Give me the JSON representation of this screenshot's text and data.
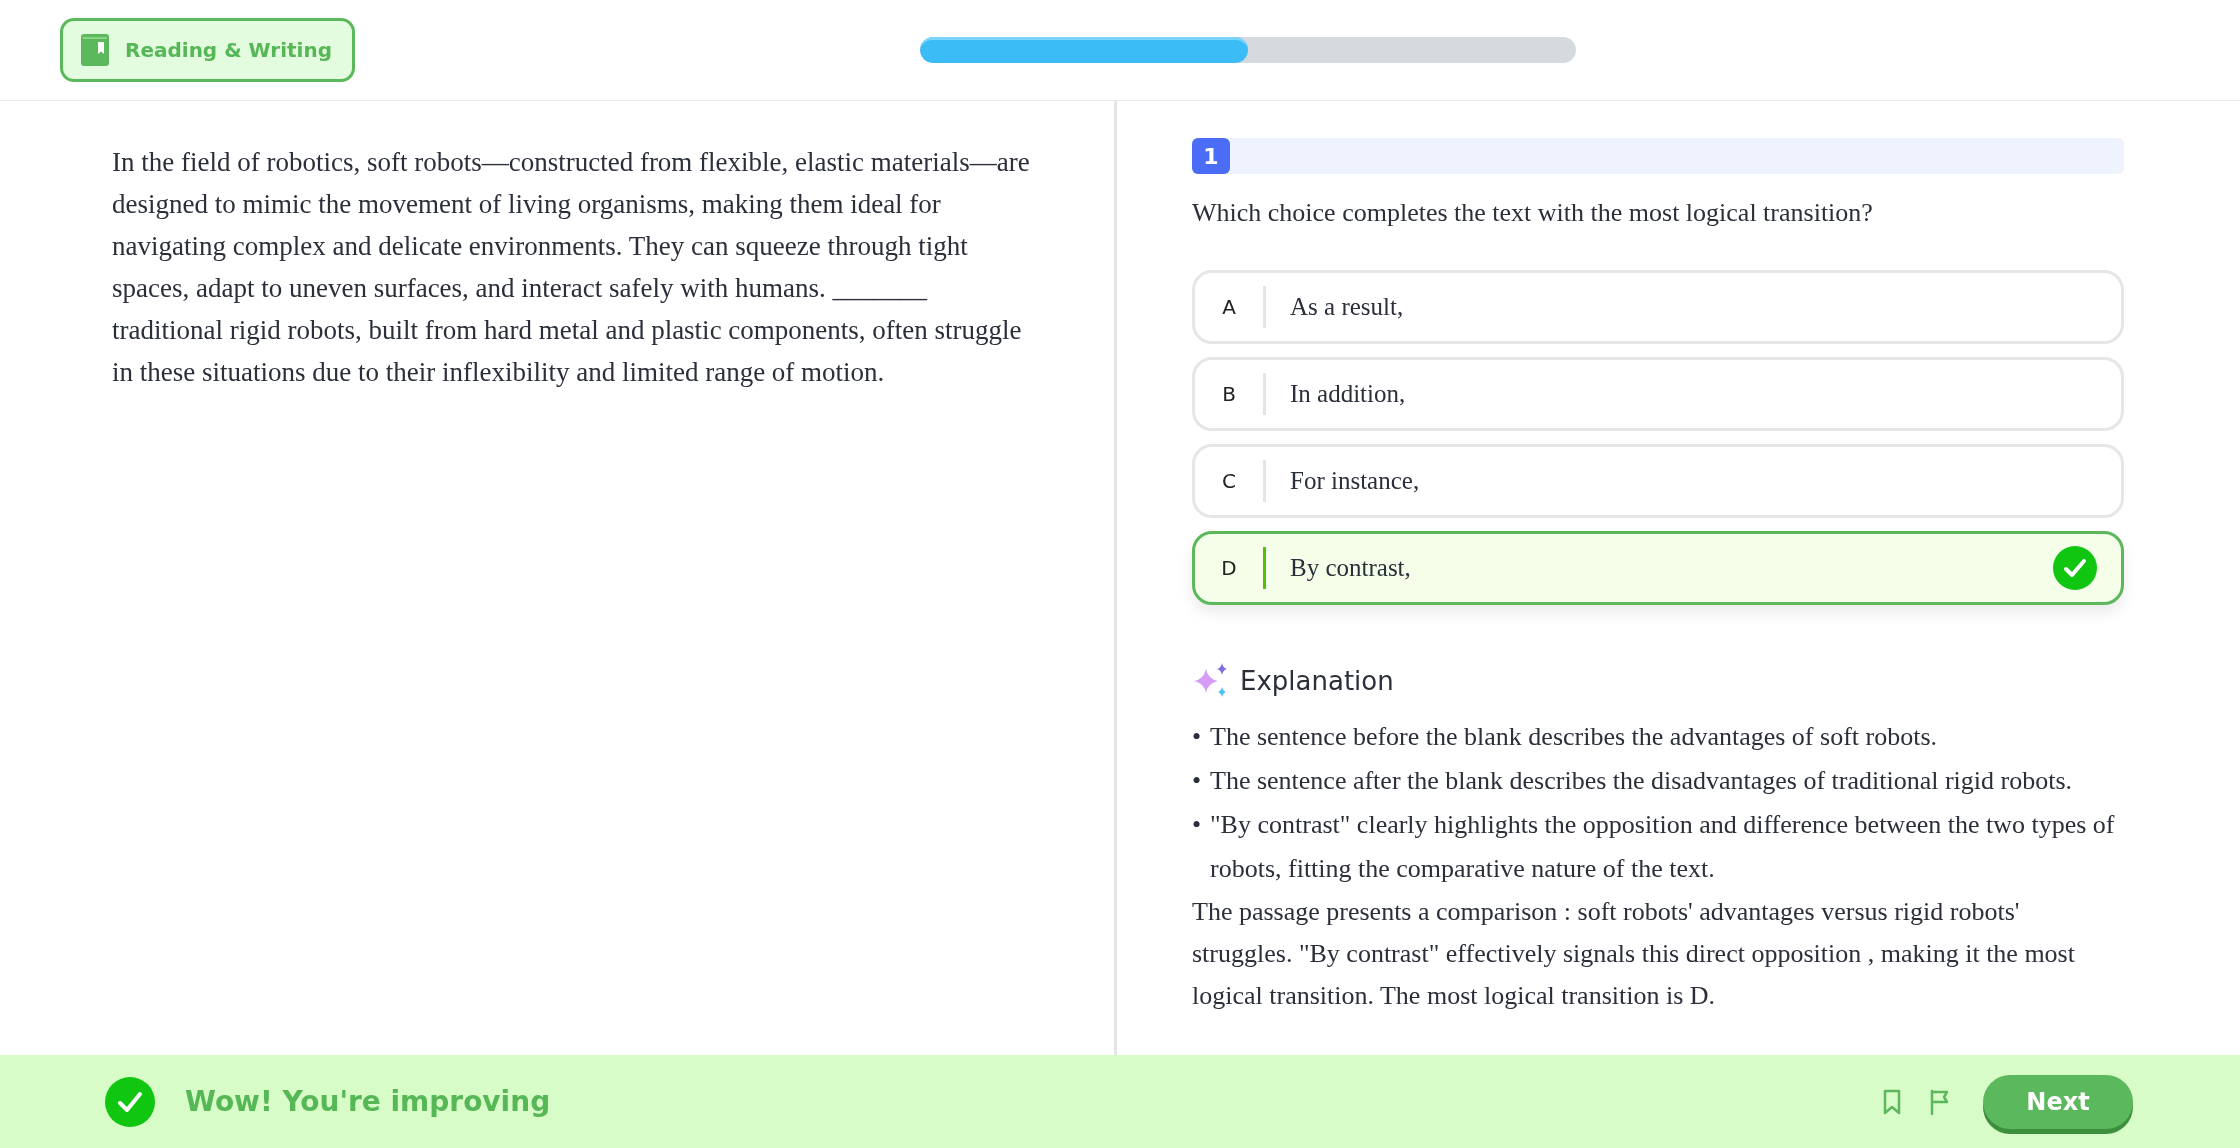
{
  "header": {
    "section_badge": "Reading & Writing",
    "progress": {
      "level": 0.5
    }
  },
  "passage": "In the field of robotics, soft robots—constructed from flexible, elastic materials—are designed to mimic the movement of living organisms, making them ideal for navigating complex and delicate environments. They can squeeze through tight spaces, adapt to uneven surfaces, and interact safely with humans. _______ traditional rigid robots, built from hard metal and plastic components, often struggle in these situations due to their inflexibility and limited range of motion.",
  "question": {
    "number": "1",
    "prompt": "Which choice completes the text with the most logical transition?",
    "choices": [
      {
        "letter": "A",
        "text": "As a result,",
        "selected": false
      },
      {
        "letter": "B",
        "text": "In addition,",
        "selected": false
      },
      {
        "letter": "C",
        "text": "For instance,",
        "selected": false
      },
      {
        "letter": "D",
        "text": "By contrast,",
        "selected": true
      }
    ]
  },
  "explanation": {
    "title": "Explanation",
    "bullets": [
      {
        "marker": "•",
        "text": "The sentence before the blank describes the advantages of soft robots."
      },
      {
        "marker": "•",
        "text": "The sentence after the blank describes the disadvantages of traditional rigid robots."
      },
      {
        "marker": "•",
        "text": "\"By contrast\" clearly highlights the opposition and difference between the two types of robots, fitting the comparative nature of the text."
      }
    ],
    "summary": "The passage presents a comparison : soft robots' advantages versus rigid robots' struggles. \"By contrast\" effectively signals this direct opposition , making it the most logical transition. The most logical transition is D."
  },
  "footer": {
    "feedback": "Wow! You're improving",
    "next_button": "Next"
  }
}
